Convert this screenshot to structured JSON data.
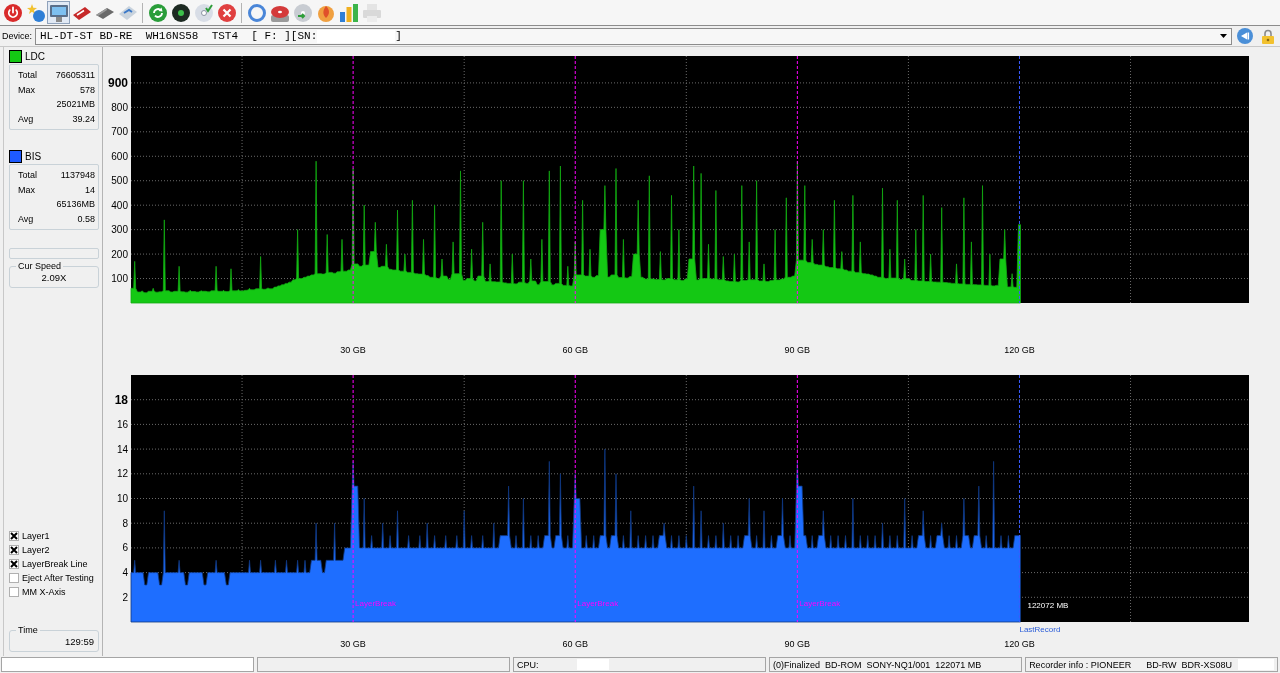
{
  "toolbar_groups": [
    [
      {
        "selected": false,
        "disabled": false
      },
      {
        "selected": false,
        "disabled": false
      },
      {
        "selected": true,
        "disabled": false
      },
      {
        "selected": false,
        "disabled": false
      },
      {
        "selected": false,
        "disabled": false
      },
      {
        "selected": false,
        "disabled": false
      }
    ],
    [
      {
        "selected": false,
        "disabled": false
      },
      {
        "selected": false,
        "disabled": false
      },
      {
        "selected": false,
        "disabled": false
      },
      {
        "selected": false,
        "disabled": false
      }
    ],
    [
      {
        "selected": false,
        "disabled": false
      },
      {
        "selected": false,
        "disabled": false
      },
      {
        "selected": false,
        "disabled": false
      },
      {
        "selected": false,
        "disabled": false
      },
      {
        "selected": false,
        "disabled": false
      },
      {
        "selected": false,
        "disabled": true
      }
    ]
  ],
  "device": {
    "label": "Device:",
    "value": "HL-DT-ST BD-RE  WH16NS58  TST4  [ F: ][SN:",
    "value_end": "]"
  },
  "side_panel": {
    "stats": [
      {
        "label": "LDC",
        "color": "#14c814",
        "rows": [
          {
            "label": "Total",
            "value": "76605311"
          },
          {
            "label": "Max",
            "value": "578"
          },
          {
            "value": "25021MB"
          },
          {
            "label": "Avg",
            "value": "39.24"
          }
        ]
      },
      {
        "label": "BIS",
        "color": "#1e5aff",
        "rows": [
          {
            "label": "Total",
            "value": "1137948"
          },
          {
            "label": "Max",
            "value": "14"
          },
          {
            "value": "65136MB"
          },
          {
            "label": "Avg",
            "value": "0.58"
          }
        ]
      }
    ],
    "speed": {
      "label": "Cur Speed",
      "value": "2.09X"
    },
    "options": [
      {
        "label": "Layer1",
        "checked": true
      },
      {
        "label": "Layer2",
        "checked": true
      },
      {
        "label": "LayerBreak Line",
        "checked": true
      },
      {
        "label": "Eject After Testing",
        "checked": false
      },
      {
        "label": "MM X-Axis",
        "checked": false
      }
    ],
    "time": {
      "label": "Time",
      "value": "129:59"
    }
  },
  "ldc_chart": {
    "chart_data": {
      "type": "area",
      "x": [
        0,
        0.5,
        1,
        1.5,
        2,
        2.5,
        3,
        3.5,
        4,
        4.5,
        5,
        5.5,
        6,
        6.5,
        7,
        7.5,
        8,
        8.5,
        9,
        9.5,
        10,
        10.5,
        11,
        11.5,
        12,
        12.5,
        13,
        13.5,
        14,
        14.5,
        15,
        15.5,
        16,
        16.5,
        17,
        17.5,
        18,
        18.5,
        19,
        19.5,
        20,
        20.5,
        21,
        21.5,
        22,
        22.5,
        23,
        23.5,
        24,
        24.5,
        25,
        25.5,
        26,
        26.5,
        27,
        27.5,
        28,
        28.5,
        29,
        29.5,
        30,
        30.5,
        31,
        31.5,
        32,
        32.5,
        33,
        33.5,
        34,
        34.5,
        35,
        35.5,
        36,
        36.5,
        37,
        37.5,
        38,
        38.5,
        39,
        39.5,
        40,
        40.5,
        41,
        41.5,
        42,
        42.5,
        43,
        43.5,
        44,
        44.5,
        45,
        45.5,
        46,
        46.5,
        47,
        47.5,
        48,
        48.5,
        49,
        49.5,
        50,
        50.5,
        51,
        51.5,
        52,
        52.5,
        53,
        53.5,
        54,
        54.5,
        55,
        55.5,
        56,
        56.5,
        57,
        57.5,
        58,
        58.5,
        59,
        59.5,
        60,
        60.5,
        61,
        61.5,
        62,
        62.5,
        63,
        63.5,
        64,
        64.5,
        65,
        65.5,
        66,
        66.5,
        67,
        67.5,
        68,
        68.5,
        69,
        69.5,
        70,
        70.5,
        71,
        71.5,
        72,
        72.5,
        73,
        73.5,
        74,
        74.5,
        75,
        75.5,
        76,
        76.5,
        77,
        77.5,
        78,
        78.5,
        79,
        79.5,
        80,
        80.5,
        81,
        81.5,
        82,
        82.5,
        83,
        83.5,
        84,
        84.5,
        85,
        85.5,
        86,
        86.5,
        87,
        87.5,
        88,
        88.5,
        89,
        89.5,
        90,
        90.5,
        91,
        91.5,
        92,
        92.5,
        93,
        93.5,
        94,
        94.5,
        95,
        95.5,
        96,
        96.5,
        97,
        97.5,
        98,
        98.5,
        99,
        99.5,
        100,
        100.5,
        101,
        101.5,
        102,
        102.5,
        103,
        103.5,
        104,
        104.5,
        105,
        105.5,
        106,
        106.5,
        107,
        107.5,
        108,
        108.5,
        109,
        109.5,
        110,
        110.5,
        111,
        111.5,
        112,
        112.5,
        113,
        113.5,
        114,
        114.5,
        115,
        115.5,
        116,
        116.5,
        117,
        117.5,
        118,
        118.5,
        119,
        119.5,
        120
      ],
      "series": [
        {
          "color": "#14c814",
          "values": [
            60,
            170,
            45,
            50,
            42,
            48,
            60,
            44,
            46,
            340,
            50,
            45,
            48,
            150,
            46,
            44,
            52,
            47,
            45,
            50,
            48,
            46,
            50,
            150,
            48,
            52,
            47,
            140,
            50,
            55,
            49,
            52,
            60,
            54,
            58,
            190,
            56,
            62,
            58,
            65,
            70,
            75,
            80,
            85,
            95,
            300,
            100,
            105,
            110,
            115,
            580,
            120,
            118,
            280,
            125,
            122,
            128,
            260,
            130,
            135,
            550,
            160,
            150,
            400,
            155,
            210,
            330,
            145,
            150,
            240,
            138,
            135,
            380,
            130,
            200,
            125,
            420,
            120,
            118,
            260,
            112,
            105,
            400,
            100,
            180,
            110,
            96,
            250,
            120,
            540,
            92,
            100,
            220,
            90,
            110,
            330,
            88,
            160,
            87,
            86,
            500,
            82,
            80,
            200,
            78,
            85,
            500,
            80,
            180,
            90,
            75,
            260,
            88,
            540,
            74,
            80,
            560,
            72,
            150,
            70,
            250,
            115,
            420,
            110,
            220,
            105,
            112,
            300,
            480,
            106,
            115,
            550,
            104,
            260,
            102,
            108,
            200,
            420,
            105,
            98,
            520,
            98,
            96,
            210,
            94,
            100,
            440,
            95,
            300,
            92,
            98,
            180,
            560,
            94,
            530,
            100,
            240,
            98,
            460,
            95,
            190,
            90,
            88,
            200,
            86,
            480,
            92,
            250,
            95,
            500,
            90,
            160,
            88,
            92,
            300,
            94,
            98,
            430,
            105,
            110,
            580,
            175,
            480,
            165,
            260,
            158,
            155,
            300,
            148,
            145,
            420,
            140,
            210,
            135,
            130,
            440,
            125,
            250,
            120,
            118,
            115,
            110,
            105,
            470,
            100,
            220,
            102,
            420,
            96,
            180,
            100,
            92,
            300,
            90,
            440,
            88,
            200,
            86,
            85,
            390,
            84,
            82,
            80,
            160,
            78,
            430,
            76,
            250,
            75,
            74,
            480,
            72,
            200,
            70,
            72,
            180,
            300,
            66,
            120,
            64,
            320
          ]
        }
      ],
      "xlim": [
        0,
        151
      ],
      "ylim": [
        0,
        1010
      ],
      "xticks": [
        {
          "value": 30,
          "label": "30 GB"
        },
        {
          "value": 60,
          "label": "60 GB"
        },
        {
          "value": 90,
          "label": "90 GB"
        },
        {
          "value": 120,
          "label": "120 GB"
        }
      ],
      "yticks": [
        100,
        200,
        300,
        400,
        500,
        600,
        700,
        800,
        900
      ],
      "grid": true,
      "ref_lines": [
        {
          "axis": "x",
          "value": 30,
          "color": "#ff00ff"
        },
        {
          "axis": "x",
          "value": 60,
          "color": "#ff00ff"
        },
        {
          "axis": "x",
          "value": 90,
          "color": "#ff00ff"
        },
        {
          "axis": "x",
          "value": 120,
          "color": "#3a5cff"
        }
      ]
    }
  },
  "bis_chart": {
    "chart_data": {
      "type": "area",
      "x": [
        0,
        0.5,
        1,
        1.5,
        2,
        2.5,
        3,
        3.5,
        4,
        4.5,
        5,
        5.5,
        6,
        6.5,
        7,
        7.5,
        8,
        8.5,
        9,
        9.5,
        10,
        10.5,
        11,
        11.5,
        12,
        12.5,
        13,
        13.5,
        14,
        14.5,
        15,
        15.5,
        16,
        16.5,
        17,
        17.5,
        18,
        18.5,
        19,
        19.5,
        20,
        20.5,
        21,
        21.5,
        22,
        22.5,
        23,
        23.5,
        24,
        24.5,
        25,
        25.5,
        26,
        26.5,
        27,
        27.5,
        28,
        28.5,
        29,
        29.5,
        30,
        30.5,
        31,
        31.5,
        32,
        32.5,
        33,
        33.5,
        34,
        34.5,
        35,
        35.5,
        36,
        36.5,
        37,
        37.5,
        38,
        38.5,
        39,
        39.5,
        40,
        40.5,
        41,
        41.5,
        42,
        42.5,
        43,
        43.5,
        44,
        44.5,
        45,
        45.5,
        46,
        46.5,
        47,
        47.5,
        48,
        48.5,
        49,
        49.5,
        50,
        50.5,
        51,
        51.5,
        52,
        52.5,
        53,
        53.5,
        54,
        54.5,
        55,
        55.5,
        56,
        56.5,
        57,
        57.5,
        58,
        58.5,
        59,
        59.5,
        60,
        60.5,
        61,
        61.5,
        62,
        62.5,
        63,
        63.5,
        64,
        64.5,
        65,
        65.5,
        66,
        66.5,
        67,
        67.5,
        68,
        68.5,
        69,
        69.5,
        70,
        70.5,
        71,
        71.5,
        72,
        72.5,
        73,
        73.5,
        74,
        74.5,
        75,
        75.5,
        76,
        76.5,
        77,
        77.5,
        78,
        78.5,
        79,
        79.5,
        80,
        80.5,
        81,
        81.5,
        82,
        82.5,
        83,
        83.5,
        84,
        84.5,
        85,
        85.5,
        86,
        86.5,
        87,
        87.5,
        88,
        88.5,
        89,
        89.5,
        90,
        90.5,
        91,
        91.5,
        92,
        92.5,
        93,
        93.5,
        94,
        94.5,
        95,
        95.5,
        96,
        96.5,
        97,
        97.5,
        98,
        98.5,
        99,
        99.5,
        100,
        100.5,
        101,
        101.5,
        102,
        102.5,
        103,
        103.5,
        104,
        104.5,
        105,
        105.5,
        106,
        106.5,
        107,
        107.5,
        108,
        108.5,
        109,
        109.5,
        110,
        110.5,
        111,
        111.5,
        112,
        112.5,
        113,
        113.5,
        114,
        114.5,
        115,
        115.5,
        116,
        116.5,
        117,
        117.5,
        118,
        118.5,
        119,
        119.5,
        120
      ],
      "series": [
        {
          "color": "#1e6eff",
          "values": [
            4,
            5,
            4,
            4,
            3,
            4,
            4,
            4,
            3,
            9,
            4,
            4,
            4,
            5,
            4,
            3,
            4,
            4,
            4,
            4,
            3,
            4,
            4,
            5,
            4,
            4,
            3,
            4,
            4,
            4,
            4,
            4,
            5,
            4,
            4,
            5,
            4,
            4,
            4,
            5,
            4,
            4,
            5,
            4,
            4,
            5,
            4,
            5,
            4,
            5,
            8,
            5,
            4,
            5,
            5,
            8,
            5,
            5,
            6,
            6,
            13,
            11,
            6,
            10,
            6,
            7,
            6,
            6,
            8,
            6,
            7,
            6,
            9,
            6,
            6,
            7,
            6,
            6,
            7,
            6,
            8,
            6,
            7,
            6,
            6,
            7,
            6,
            6,
            7,
            6,
            9,
            6,
            7,
            6,
            6,
            7,
            6,
            6,
            8,
            6,
            7,
            7,
            11,
            6,
            7,
            6,
            10,
            6,
            7,
            6,
            7,
            6,
            7,
            13,
            6,
            7,
            12,
            6,
            7,
            6,
            12,
            10,
            6,
            7,
            6,
            7,
            6,
            7,
            14,
            6,
            7,
            12,
            6,
            7,
            6,
            9,
            6,
            7,
            6,
            7,
            6,
            7,
            6,
            7,
            8,
            6,
            7,
            6,
            7,
            6,
            7,
            6,
            11,
            6,
            9,
            6,
            7,
            6,
            7,
            6,
            8,
            6,
            7,
            6,
            7,
            6,
            7,
            10,
            6,
            7,
            6,
            9,
            6,
            7,
            6,
            7,
            10,
            6,
            7,
            6,
            13,
            11,
            7,
            6,
            7,
            6,
            7,
            9,
            6,
            7,
            6,
            7,
            6,
            7,
            6,
            10,
            6,
            7,
            6,
            7,
            6,
            7,
            6,
            8,
            6,
            7,
            6,
            7,
            6,
            10,
            6,
            7,
            6,
            7,
            9,
            6,
            7,
            6,
            7,
            8,
            6,
            7,
            6,
            7,
            6,
            10,
            7,
            6,
            7,
            11,
            6,
            7,
            6,
            13,
            6,
            7,
            6,
            7,
            6,
            7,
            7
          ]
        }
      ],
      "xlim": [
        0,
        151
      ],
      "ylim": [
        0,
        20
      ],
      "xticks": [
        {
          "value": 30,
          "label": "30 GB"
        },
        {
          "value": 60,
          "label": "60 GB"
        },
        {
          "value": 90,
          "label": "90 GB"
        },
        {
          "value": 120,
          "label": "120 GB"
        }
      ],
      "yticks": [
        2,
        4,
        6,
        8,
        10,
        12,
        14,
        16,
        18
      ],
      "grid": true,
      "ref_lines": [
        {
          "axis": "x",
          "value": 30,
          "color": "#ff00ff",
          "label": "LayerBreak"
        },
        {
          "axis": "x",
          "value": 60,
          "color": "#ff00ff",
          "label": "LayerBreak"
        },
        {
          "axis": "x",
          "value": 90,
          "color": "#ff00ff",
          "label": "LayerBreak"
        },
        {
          "axis": "x",
          "value": 120,
          "color": "#3a5cff"
        }
      ],
      "annotations": [
        {
          "text": "122072 MB",
          "x": 120,
          "y": 1.4
        },
        "LastRecord"
      ]
    }
  },
  "status_bar": {
    "cpu_label": "CPU:",
    "disc_info": "(0)Finalized  BD-ROM  SONY-NQ1/001  122071 MB",
    "recorder_info": "Recorder info : PIONEER      BD-RW  BDR-XS08U"
  }
}
